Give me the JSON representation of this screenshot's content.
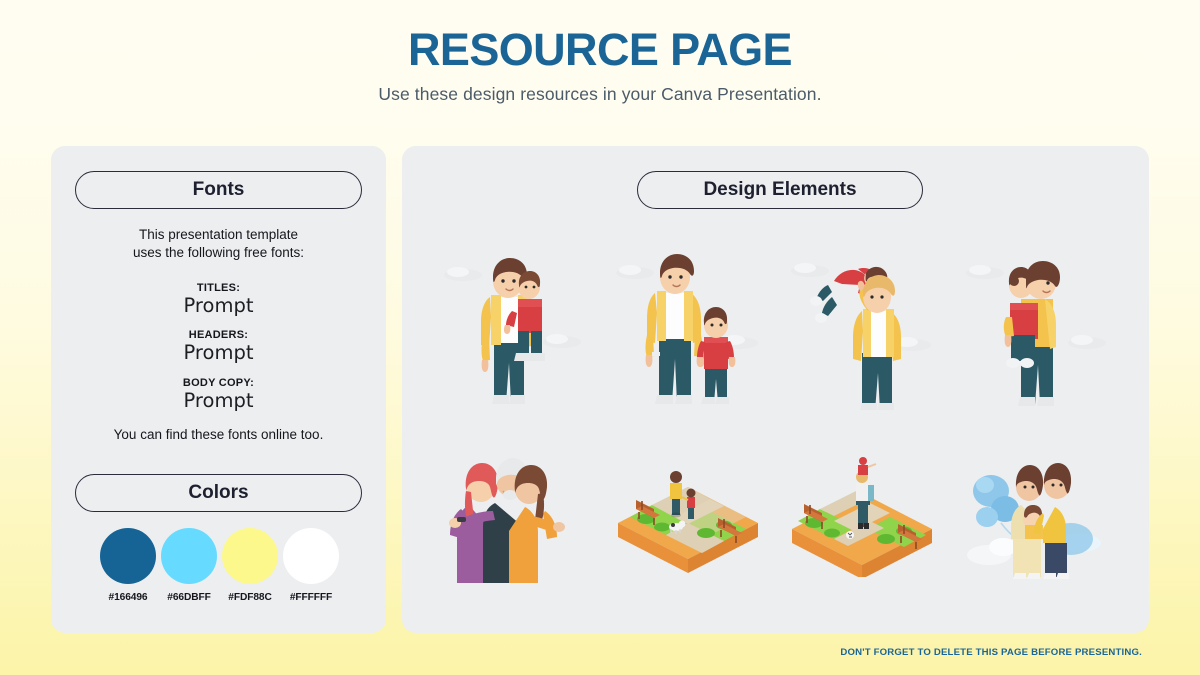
{
  "header": {
    "title": "RESOURCE PAGE",
    "subtitle": "Use these design resources in your Canva Presentation."
  },
  "fonts_panel": {
    "pill_label": "Fonts",
    "intro_line_1": "This presentation template",
    "intro_line_2": "uses the following free fonts:",
    "specs": [
      {
        "label": "TITLES:",
        "font_name": "Prompt"
      },
      {
        "label": "HEADERS:",
        "font_name": "Prompt"
      },
      {
        "label": "BODY COPY:",
        "font_name": "Prompt"
      }
    ],
    "outro": "You can find these fonts online too."
  },
  "colors_panel": {
    "pill_label": "Colors",
    "swatches": [
      {
        "hex_label": "#166496",
        "color": "#166496"
      },
      {
        "hex_label": "#66DBFF",
        "color": "#66DBFF"
      },
      {
        "hex_label": "#FDF88C",
        "color": "#FDF88C"
      },
      {
        "hex_label": "#FFFFFF",
        "color": "#FFFFFF"
      }
    ]
  },
  "design_panel": {
    "pill_label": "Design Elements",
    "elements": [
      {
        "name": "parent-carrying-child-piggyback-illustration"
      },
      {
        "name": "parent-holding-child-hand-illustration"
      },
      {
        "name": "parent-lifting-child-in-air-illustration"
      },
      {
        "name": "parent-hugging-child-illustration"
      },
      {
        "name": "family-group-hug-illustration"
      },
      {
        "name": "park-scene-with-dog-illustration"
      },
      {
        "name": "park-scene-child-on-shoulders-illustration"
      },
      {
        "name": "family-with-baby-and-balloons-illustration"
      }
    ]
  },
  "footer": {
    "note": "DON'T FORGET TO DELETE THIS PAGE BEFORE PRESENTING."
  },
  "theme": {
    "title_color": "#166496",
    "subtitle_color": "#4B5B69",
    "panel_bg": "#ECEEF0",
    "pill_border": "#2B2B3C",
    "footer_color": "#166496"
  }
}
